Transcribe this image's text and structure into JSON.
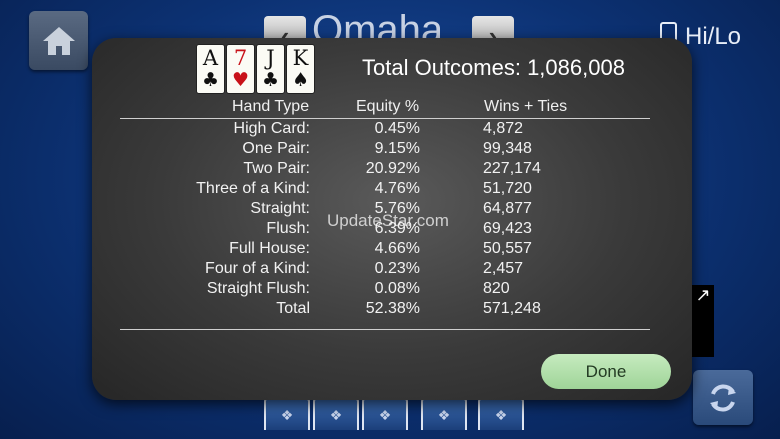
{
  "background": {
    "title": "Omaha",
    "hilo_label": "Hi/Lo"
  },
  "modal": {
    "hand": [
      {
        "rank": "A",
        "suit": "♣",
        "color": "black"
      },
      {
        "rank": "7",
        "suit": "♥",
        "color": "red"
      },
      {
        "rank": "J",
        "suit": "♣",
        "color": "black"
      },
      {
        "rank": "K",
        "suit": "♠",
        "color": "black"
      }
    ],
    "total_outcomes": "Total Outcomes: 1,086,008",
    "headers": {
      "hand_type": "Hand Type",
      "equity": "Equity %",
      "wins_ties": "Wins + Ties"
    },
    "rows": [
      {
        "type": "High Card:",
        "equity": "0.45%",
        "wins": "4,872"
      },
      {
        "type": "One Pair:",
        "equity": "9.15%",
        "wins": "99,348"
      },
      {
        "type": "Two Pair:",
        "equity": "20.92%",
        "wins": "227,174"
      },
      {
        "type": "Three of a Kind:",
        "equity": "4.76%",
        "wins": "51,720"
      },
      {
        "type": "Straight:",
        "equity": "5.76%",
        "wins": "64,877"
      },
      {
        "type": "Flush:",
        "equity": "6.39%",
        "wins": "69,423"
      },
      {
        "type": "Full House:",
        "equity": "4.66%",
        "wins": "50,557"
      },
      {
        "type": "Four of a Kind:",
        "equity": "0.23%",
        "wins": "2,457"
      },
      {
        "type": "Straight Flush:",
        "equity": "0.08%",
        "wins": "820"
      },
      {
        "type": "Total",
        "equity": "52.38%",
        "wins": "571,248"
      }
    ],
    "watermark": "UpdateStar.com",
    "done_label": "Done"
  }
}
